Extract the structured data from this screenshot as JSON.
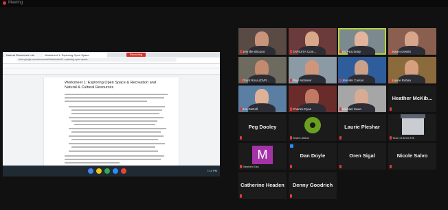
{
  "window": {
    "title": "Meeting"
  },
  "browser": {
    "tabs": [
      {
        "label": "Natural Resources Lab"
      },
      {
        "label": "Worksheet 1: Exploring Open Space"
      }
    ],
    "recording_label": "Recording",
    "url": "docs.google.com/document/d/worksheet-1-exploring-open-space"
  },
  "document": {
    "title": "Worksheet 1: Exploring Open Space & Recreation and Natural & Cultural Resources"
  },
  "taskbar": {
    "clock": "7:14 PM"
  },
  "participants": [
    {
      "name": "Jennifer Bitcourt",
      "video": true,
      "skin": "#c9957a",
      "bg": "#5a4a44"
    },
    {
      "name": "TAPESTA Com...",
      "video": true,
      "skin": "#d7a98a",
      "bg": "#6b3a3a"
    },
    {
      "name": "Ed Pezzinsky",
      "video": true,
      "skin": "#e1b49b",
      "bg": "#7a8a8f",
      "active": true
    },
    {
      "name": "Karen DeWitt",
      "video": true,
      "skin": "#d8a58c",
      "bg": "#8a5f4f"
    },
    {
      "name": "Grant Rosa (DVR...",
      "video": true,
      "skin": "#c28a6e",
      "bg": "#6d6a5f"
    },
    {
      "name": "Paul Motisner",
      "video": true,
      "skin": "#d0967b",
      "bg": "#8c9aa6"
    },
    {
      "name": "Jennifer Carson",
      "video": true,
      "skin": "#caa08a",
      "bg": "#2f5d9b"
    },
    {
      "name": "Laurie Rohan",
      "video": true,
      "skin": "#d4a080",
      "bg": "#8b6a3c"
    },
    {
      "name": "Joe DeRell",
      "video": true,
      "skin": "#dfb197",
      "bg": "#5b7fa3"
    },
    {
      "name": "Charles Ryan",
      "video": true,
      "skin": "#c07a64",
      "bg": "#6a2b2b"
    },
    {
      "name": "Michael Swan",
      "video": true,
      "skin": "#d8ab94",
      "bg": "#a6a6a6"
    },
    {
      "name": "Heather McKib...",
      "video": false
    },
    {
      "name": "Peg Dooley",
      "video": false
    },
    {
      "name": "Shane Allison",
      "video": false,
      "logo": true
    },
    {
      "name": "Laurie Pleshar",
      "video": false
    },
    {
      "name": "Town of Ames Hill",
      "video": false,
      "house": true
    },
    {
      "name": "Stephen Kiss",
      "video": false,
      "avatar_letter": "M",
      "avatar_color": "#a533a8"
    },
    {
      "name": "Dan Doyle",
      "video": false,
      "badge": true
    },
    {
      "name": "Oren Sigal",
      "video": false
    },
    {
      "name": "Nicole Salvo",
      "video": false
    },
    {
      "name": "Catherine Headen",
      "video": false
    },
    {
      "name": "Denny Goodrich",
      "video": false
    }
  ]
}
